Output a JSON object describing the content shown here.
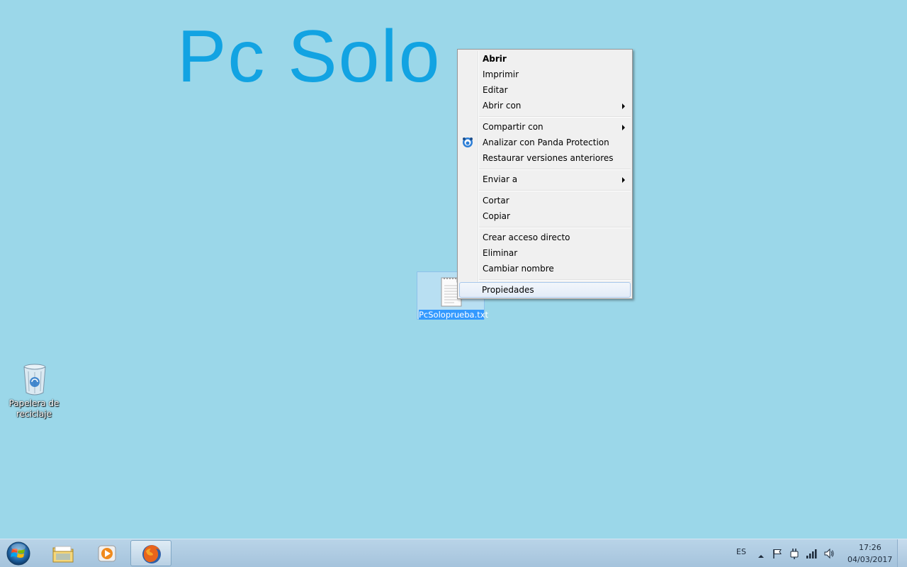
{
  "wallpaper": {
    "text": "Pc Solo",
    "background_color": "#9bd7e9",
    "text_color": "#12a3e2"
  },
  "desktop_icons": [
    {
      "label": "PcSoloprueba.txt",
      "icon": "text-file-icon",
      "selected": true
    },
    {
      "label": "Papelera de reciclaje",
      "icon": "recycle-bin-icon",
      "selected": false
    }
  ],
  "context_menu": {
    "items": [
      {
        "label": "Abrir",
        "bold": true
      },
      {
        "label": "Imprimir"
      },
      {
        "label": "Editar"
      },
      {
        "label": "Abrir con",
        "submenu": true
      },
      {
        "label": "Compartir con",
        "submenu": true
      },
      {
        "label": "Analizar con Panda Protection",
        "icon": "panda-protection-icon"
      },
      {
        "label": "Restaurar versiones anteriores"
      },
      {
        "label": "Enviar a",
        "submenu": true
      },
      {
        "label": "Cortar"
      },
      {
        "label": "Copiar"
      },
      {
        "label": "Crear acceso directo"
      },
      {
        "label": "Eliminar"
      },
      {
        "label": "Cambiar nombre"
      },
      {
        "label": "Propiedades",
        "highlighted": true
      }
    ]
  },
  "taskbar": {
    "pinned": [
      {
        "name": "Windows Explorer",
        "icon": "folder-icon"
      },
      {
        "name": "Windows Media Player",
        "icon": "media-player-icon"
      },
      {
        "name": "Firefox",
        "icon": "firefox-icon",
        "active": true
      }
    ],
    "tray": {
      "language": "ES",
      "icons": [
        "show-hidden-icons-arrow",
        "action-center-flag-icon",
        "power-plug-icon",
        "network-signal-icon",
        "volume-icon"
      ]
    },
    "clock": {
      "time": "17:26",
      "date": "04/03/2017"
    }
  }
}
